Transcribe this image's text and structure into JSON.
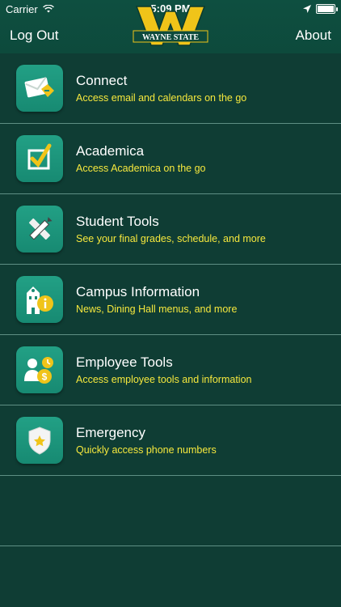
{
  "status": {
    "carrier": "Carrier",
    "time": "5:09 PM"
  },
  "nav": {
    "left_label": "Log Out",
    "right_label": "About",
    "logo_text": "WAYNE STATE"
  },
  "menu": [
    {
      "title": "Connect",
      "subtitle": "Access email and calendars on the go",
      "icon": "mail-icon"
    },
    {
      "title": "Academica",
      "subtitle": "Access Academica on the go",
      "icon": "checklist-icon"
    },
    {
      "title": "Student Tools",
      "subtitle": "See your final grades, schedule, and more",
      "icon": "pencil-ruler-icon"
    },
    {
      "title": "Campus Information",
      "subtitle": "News, Dining Hall menus, and more",
      "icon": "campus-info-icon"
    },
    {
      "title": "Employee Tools",
      "subtitle": "Access employee tools and information",
      "icon": "employee-icon"
    },
    {
      "title": "Emergency",
      "subtitle": "Quickly access phone numbers",
      "icon": "shield-star-icon"
    }
  ],
  "colors": {
    "background": "#0f3d34",
    "accent": "#1a9a7e",
    "subtitle": "#f6e83d"
  }
}
